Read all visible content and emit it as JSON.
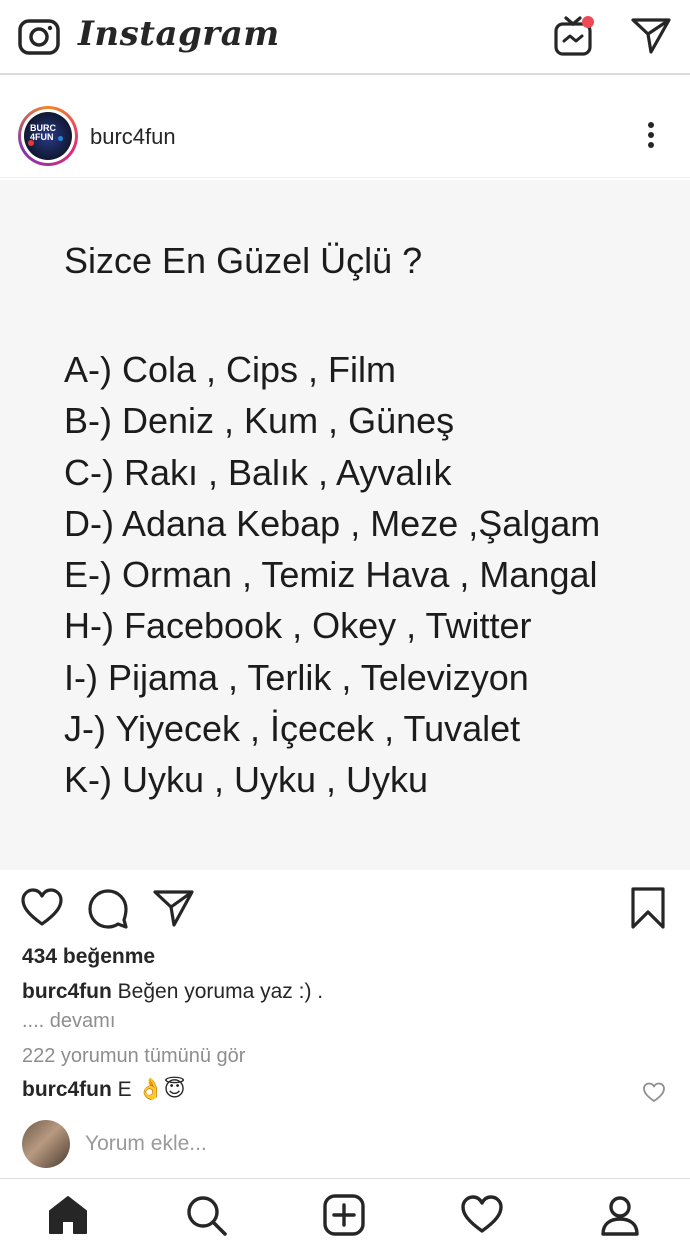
{
  "header": {
    "app_title": "Instagram",
    "icons": {
      "camera": "camera-icon",
      "igtv": "igtv-icon",
      "direct": "direct-message-icon"
    },
    "notification_dot_color": "#ed4956"
  },
  "post": {
    "username": "burc4fun",
    "avatar_text": "BURC 4FUN",
    "image": {
      "title": "Sizce En Güzel Üçlü ?",
      "options": [
        "A-) Cola , Cips , Film",
        "B-) Deniz , Kum , Güneş",
        "C-) Rakı , Balık , Ayvalık",
        "D-) Adana Kebap , Meze ,Şalgam",
        "E-) Orman , Temiz Hava , Mangal",
        "H-) Facebook , Okey , Twitter",
        "I-) Pijama , Terlik , Televizyon",
        "J-) Yiyecek , İçecek , Tuvalet",
        "K-) Uyku , Uyku , Uyku"
      ]
    },
    "likes": "434 beğenme",
    "caption": {
      "user": "burc4fun",
      "text": " Beğen yoruma yaz :) ."
    },
    "more_label": ".... devamı",
    "view_comments": "222 yorumun tümünü gör",
    "comment": {
      "user": "burc4fun",
      "text": " E 👌😇"
    },
    "add_comment_placeholder": "Yorum ekle..."
  },
  "bottom_nav": [
    "home-icon",
    "search-icon",
    "new-post-icon",
    "activity-heart-icon",
    "profile-icon"
  ]
}
